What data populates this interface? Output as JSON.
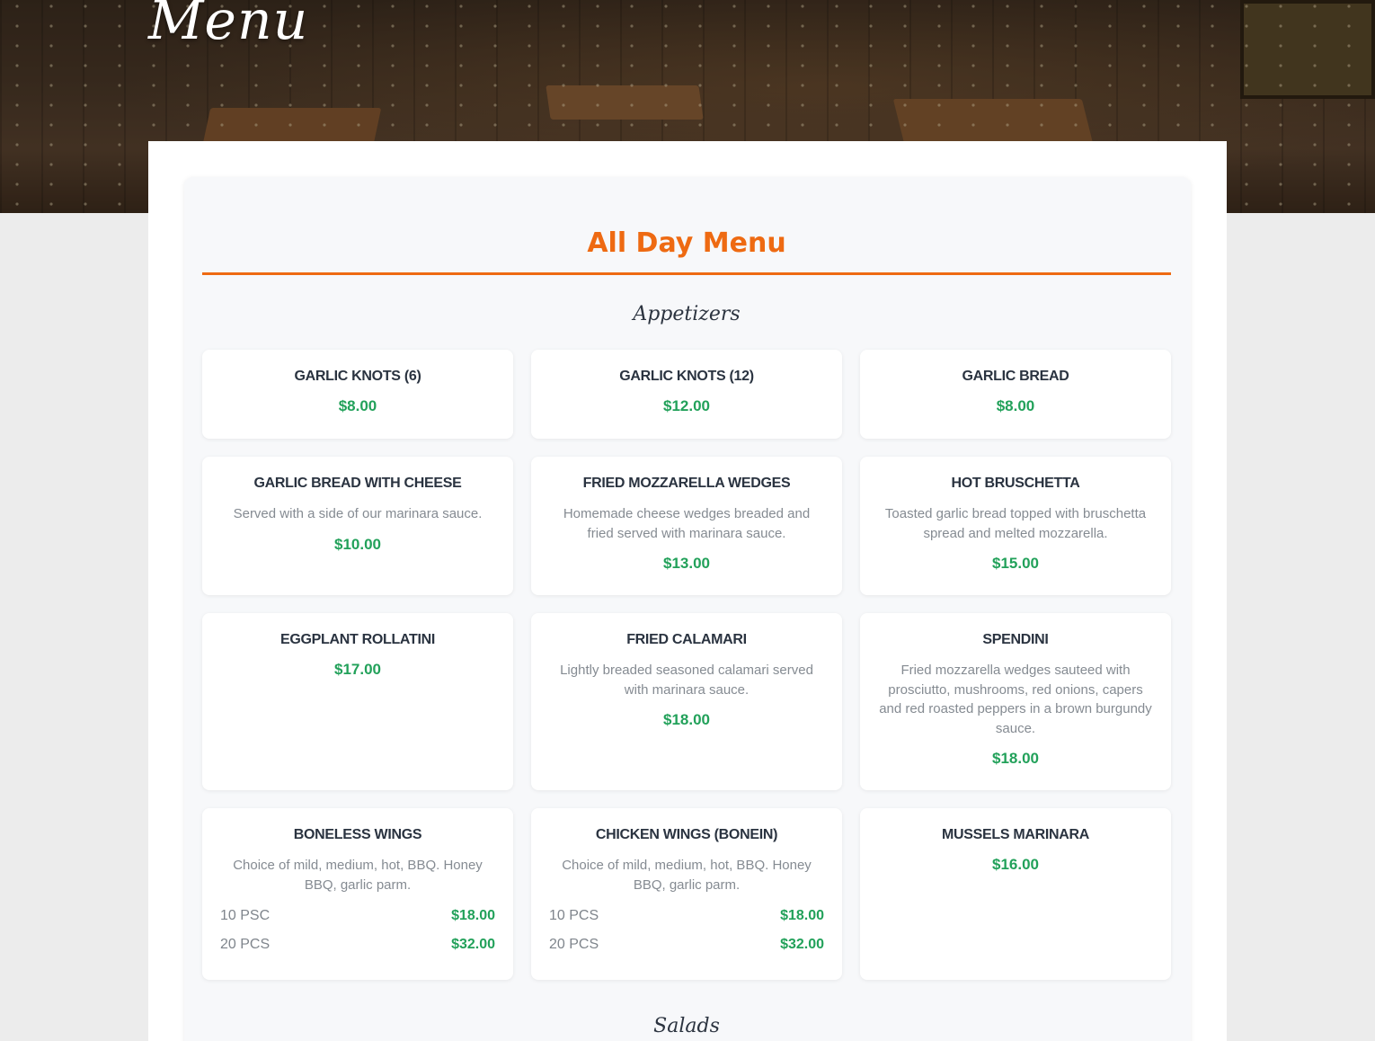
{
  "hero": {
    "title": "Menu"
  },
  "menu": {
    "heading": "All Day Menu"
  },
  "sections": [
    {
      "title": "Appetizers",
      "items": [
        {
          "name": "Garlic Knots (6)",
          "price": "$8.00"
        },
        {
          "name": "Garlic Knots (12)",
          "price": "$12.00"
        },
        {
          "name": "Garlic Bread",
          "price": "$8.00"
        },
        {
          "name": "Garlic Bread With Cheese",
          "desc": "Served with a side of our marinara sauce.",
          "price": "$10.00"
        },
        {
          "name": "Fried Mozzarella Wedges",
          "desc": "Homemade cheese wedges breaded and fried served with marinara sauce.",
          "price": "$13.00"
        },
        {
          "name": "Hot Bruschetta",
          "desc": "Toasted garlic bread topped with bruschetta spread and melted mozzarella.",
          "price": "$15.00"
        },
        {
          "name": "Eggplant Rollatini",
          "price": "$17.00"
        },
        {
          "name": "Fried Calamari",
          "desc": "Lightly breaded seasoned calamari served with marinara sauce.",
          "price": "$18.00"
        },
        {
          "name": "Spendini",
          "desc": "Fried mozzarella wedges sauteed with prosciutto, mushrooms, red onions, capers and red roasted peppers in a brown burgundy sauce.",
          "price": "$18.00"
        },
        {
          "name": "Boneless Wings",
          "desc": "Choice of mild, medium, hot, BBQ. Honey BBQ, garlic parm.",
          "variants": [
            {
              "label": "10 PSC",
              "price": "$18.00"
            },
            {
              "label": "20 PCS",
              "price": "$32.00"
            }
          ]
        },
        {
          "name": "Chicken Wings (Bonein)",
          "desc": "Choice of mild, medium, hot, BBQ. Honey BBQ, garlic parm.",
          "variants": [
            {
              "label": "10 PCS",
              "price": "$18.00"
            },
            {
              "label": "20 PCS",
              "price": "$32.00"
            }
          ]
        },
        {
          "name": "Mussels Marinara",
          "price": "$16.00"
        }
      ]
    },
    {
      "title": "Salads"
    }
  ]
}
